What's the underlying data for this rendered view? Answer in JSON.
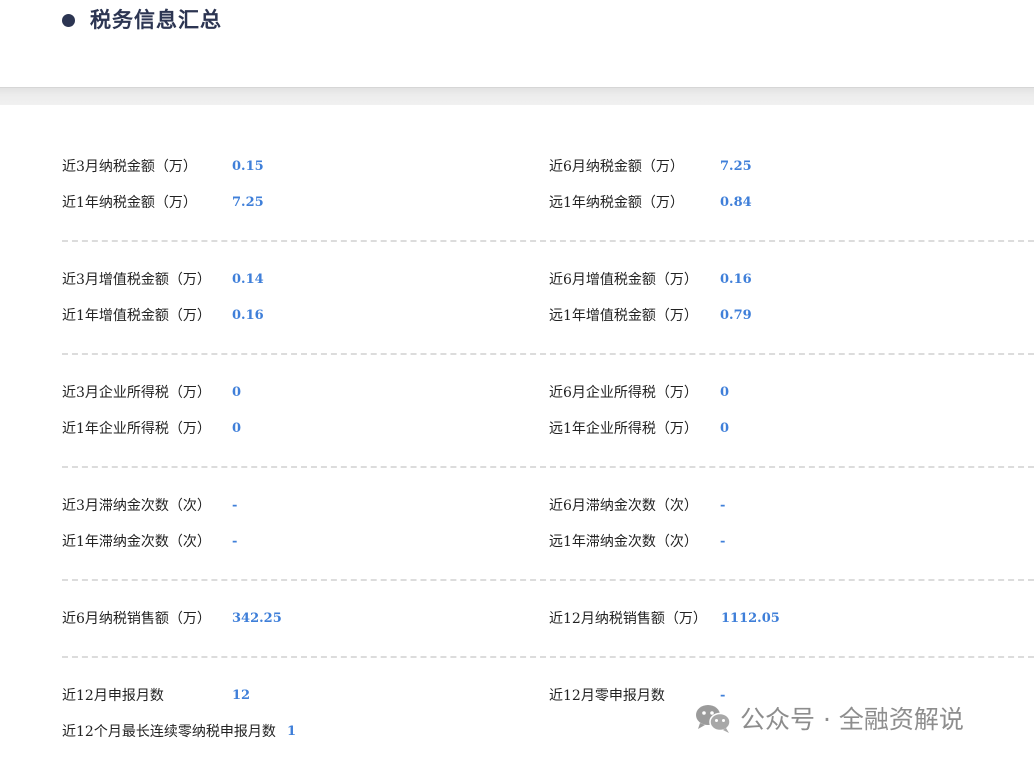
{
  "header": {
    "title": "税务信息汇总"
  },
  "sections": [
    {
      "rows": [
        {
          "left": {
            "label": "近3月纳税金额（万）",
            "value": "0.15"
          },
          "right": {
            "label": "近6月纳税金额（万）",
            "value": "7.25"
          }
        },
        {
          "left": {
            "label": "近1年纳税金额（万）",
            "value": "7.25"
          },
          "right": {
            "label": "远1年纳税金额（万）",
            "value": "0.84"
          }
        }
      ]
    },
    {
      "rows": [
        {
          "left": {
            "label": "近3月增值税金额（万）",
            "value": "0.14"
          },
          "right": {
            "label": "近6月增值税金额（万）",
            "value": "0.16"
          }
        },
        {
          "left": {
            "label": "近1年增值税金额（万）",
            "value": "0.16"
          },
          "right": {
            "label": "远1年增值税金额（万）",
            "value": "0.79"
          }
        }
      ]
    },
    {
      "rows": [
        {
          "left": {
            "label": "近3月企业所得税（万）",
            "value": "0"
          },
          "right": {
            "label": "近6月企业所得税（万）",
            "value": "0"
          }
        },
        {
          "left": {
            "label": "近1年企业所得税（万）",
            "value": "0"
          },
          "right": {
            "label": "远1年企业所得税（万）",
            "value": "0"
          }
        }
      ]
    },
    {
      "rows": [
        {
          "left": {
            "label": "近3月滞纳金次数（次）",
            "value": "-"
          },
          "right": {
            "label": "近6月滞纳金次数（次）",
            "value": "-"
          }
        },
        {
          "left": {
            "label": "近1年滞纳金次数（次）",
            "value": "-"
          },
          "right": {
            "label": "远1年滞纳金次数（次）",
            "value": "-"
          }
        }
      ]
    },
    {
      "rows": [
        {
          "left": {
            "label": "近6月纳税销售额（万）",
            "value": "342.25"
          },
          "right": {
            "label": "近12月纳税销售额（万）",
            "value": "1112.05"
          }
        }
      ]
    },
    {
      "rows": [
        {
          "left": {
            "label": "近12月申报月数",
            "value": "12"
          },
          "right": {
            "label": "近12月零申报月数",
            "value": "-"
          }
        },
        {
          "left": {
            "label": "近12个月最长连续零纳税申报月数",
            "value": "1"
          }
        }
      ]
    }
  ],
  "watermark": {
    "text": "公众号 · 全融资解说",
    "icon": "wechat-icon"
  },
  "colors": {
    "title": "#2c3552",
    "value": "#3f7fd9",
    "divider": "#dcdcdc"
  }
}
